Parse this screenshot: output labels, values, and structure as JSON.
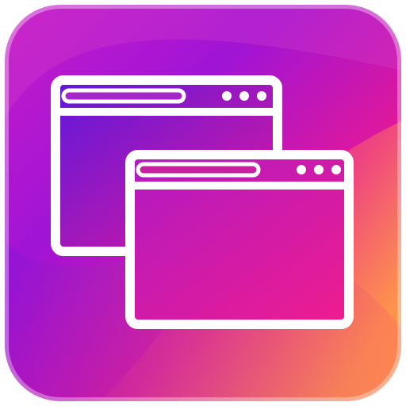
{
  "icon": {
    "name": "multiple-browser-windows-icon",
    "colors": {
      "gradient_purple": "#8a12d8",
      "gradient_magenta": "#e0189a",
      "gradient_orange": "#ff8a3d",
      "window_fill_top_left": "#6c1bd6",
      "window_fill_bottom_right": "#e3179a",
      "outline": "#ffffff",
      "page_background": "#ffffff"
    },
    "windows": [
      {
        "name": "back-window",
        "dots": 3
      },
      {
        "name": "front-window",
        "dots": 3
      }
    ]
  }
}
